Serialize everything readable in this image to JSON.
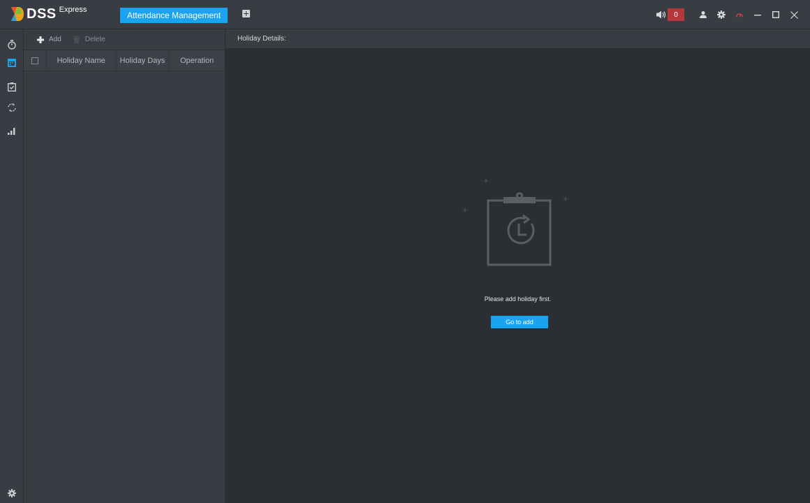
{
  "app": {
    "brand": "DSS",
    "edition": "Express"
  },
  "tabs": [
    {
      "label": "Attendance Management",
      "active": true
    }
  ],
  "topbar": {
    "alarm_count": "0",
    "icons": [
      "speaker-icon",
      "user-icon",
      "settings-icon",
      "performance-gauge-icon",
      "minimize-icon",
      "maximize-icon",
      "close-icon"
    ]
  },
  "colors": {
    "accent": "#1aa3ee",
    "alarm": "#b3373b",
    "background": "#2b2e33",
    "panel": "#393c42"
  },
  "sidebar": {
    "items": [
      {
        "icon": "timer-icon",
        "active": false
      },
      {
        "icon": "calendar-icon",
        "active": true
      },
      {
        "icon": "clipboard-check-icon",
        "active": false
      },
      {
        "icon": "refresh-icon",
        "active": false
      },
      {
        "icon": "bar-chart-icon",
        "active": false
      }
    ],
    "bottom_icon": "settings-icon"
  },
  "holiday_list": {
    "toolbar": {
      "add_label": "Add",
      "delete_label": "Delete"
    },
    "columns": [
      "Holiday Name",
      "Holiday Days",
      "Operation"
    ],
    "rows": []
  },
  "details": {
    "title": "Holiday Details:",
    "empty_message": "Please add holiday first.",
    "go_button": "Go to add"
  }
}
